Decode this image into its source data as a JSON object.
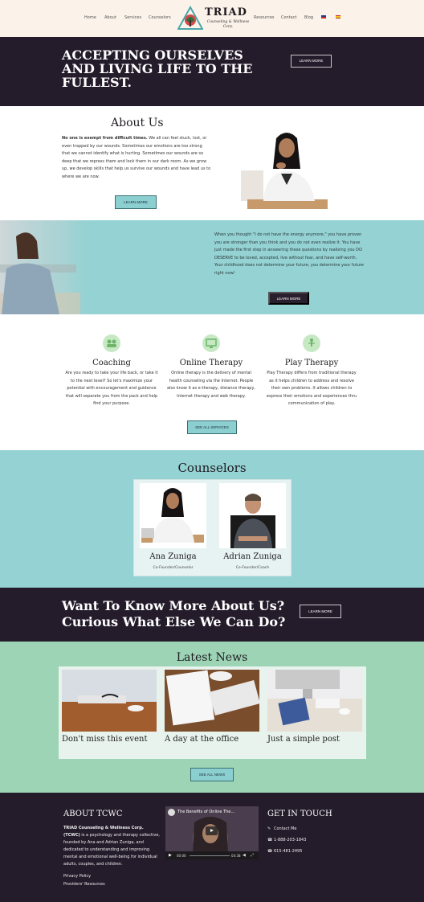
{
  "nav": {
    "left": [
      "Home",
      "About",
      "Services",
      "Counselors"
    ],
    "right": [
      "Resources",
      "Contact",
      "Blog"
    ]
  },
  "logo": {
    "name": "TRIAD",
    "sub": "Counseling & Wellness Corp."
  },
  "hero": {
    "title": "ACCEPTING OURSELVES AND LIVING LIFE TO THE FULLEST.",
    "button": "LEARN MORE"
  },
  "about": {
    "heading": "About Us",
    "lead": "No one is exempt from difficult times.",
    "body": " We all can feel stuck, lost, or even trapped by our wounds. Sometimes our emotions are too strong that we cannot identify what is hurting. Sometimes our wounds are so deep that we repress them and lock them in our dark room. As we grow up, we develop skills that help us survive our wounds and have lead us to where we are now.",
    "button": "LEARN MORE"
  },
  "band": {
    "text": "When you thought \"I do not have the energy anymore,\" you have proven you are stronger than you think and you do not even realize it. You have just made the first step in answering these questions by realizing you DO DESERVE to be loved, accepted, live without fear, and have self-worth. Your childhood does not determine your future, you determine your future right now!",
    "button": "LEARN MORE"
  },
  "services": {
    "items": [
      {
        "title": "Coaching",
        "icon": "people-icon",
        "text": "Are you ready to take your life back, or take it to the next level? So let's maximize your potential with encouragement and guidance that will separate you from the pack and help find your purpose."
      },
      {
        "title": "Online Therapy",
        "icon": "monitor-icon",
        "text": "Online therapy is the delivery of mental health counseling via the Internet. People also know it as e-therapy, distance therapy, Internet therapy and web therapy."
      },
      {
        "title": "Play Therapy",
        "icon": "child-icon",
        "text": "Play Therapy differs from traditional therapy as it helps children to address and resolve their own problems. It allows children to express their emotions and experiences thru communication of play."
      }
    ],
    "button": "SEE ALL SERVICES"
  },
  "counselors": {
    "heading": "Counselors",
    "people": [
      {
        "name": "Ana Zuniga",
        "role": "Co-Founder/Counselor"
      },
      {
        "name": "Adrian Zuniga",
        "role": "Co-Founder/Coach"
      }
    ]
  },
  "cta": {
    "title": "Want To Know More About Us? Curious What Else We Can Do?",
    "button": "LEARN MORE"
  },
  "news": {
    "heading": "Latest News",
    "posts": [
      "Don't miss this event",
      "A day at the office",
      "Just a simple post"
    ],
    "button": "SEE ALL NEWS"
  },
  "footer": {
    "about_heading": "ABOUT TCWC",
    "about_bold": "TRIAD Counseling & Wellness Corp. (TCWC)",
    "about_text": " is a psychology and therapy collective, founded by Ana and Adrian Zuniga, and dedicated to understanding and improving mental and emotional well-being for individual adults, couples, and children.",
    "links": [
      "Privacy Policy",
      "Providers' Resources"
    ],
    "video": {
      "title": "The Benefits of Online The...",
      "time_current": "00:00",
      "time_total": "04:38"
    },
    "contact_heading": "GET IN TOUCH",
    "contact": [
      {
        "icon": "pencil-icon",
        "text": "Contact Me"
      },
      {
        "icon": "phone-icon",
        "text": "1-888-203-1843"
      },
      {
        "icon": "phone-icon",
        "text": "615-481-2495"
      }
    ]
  }
}
